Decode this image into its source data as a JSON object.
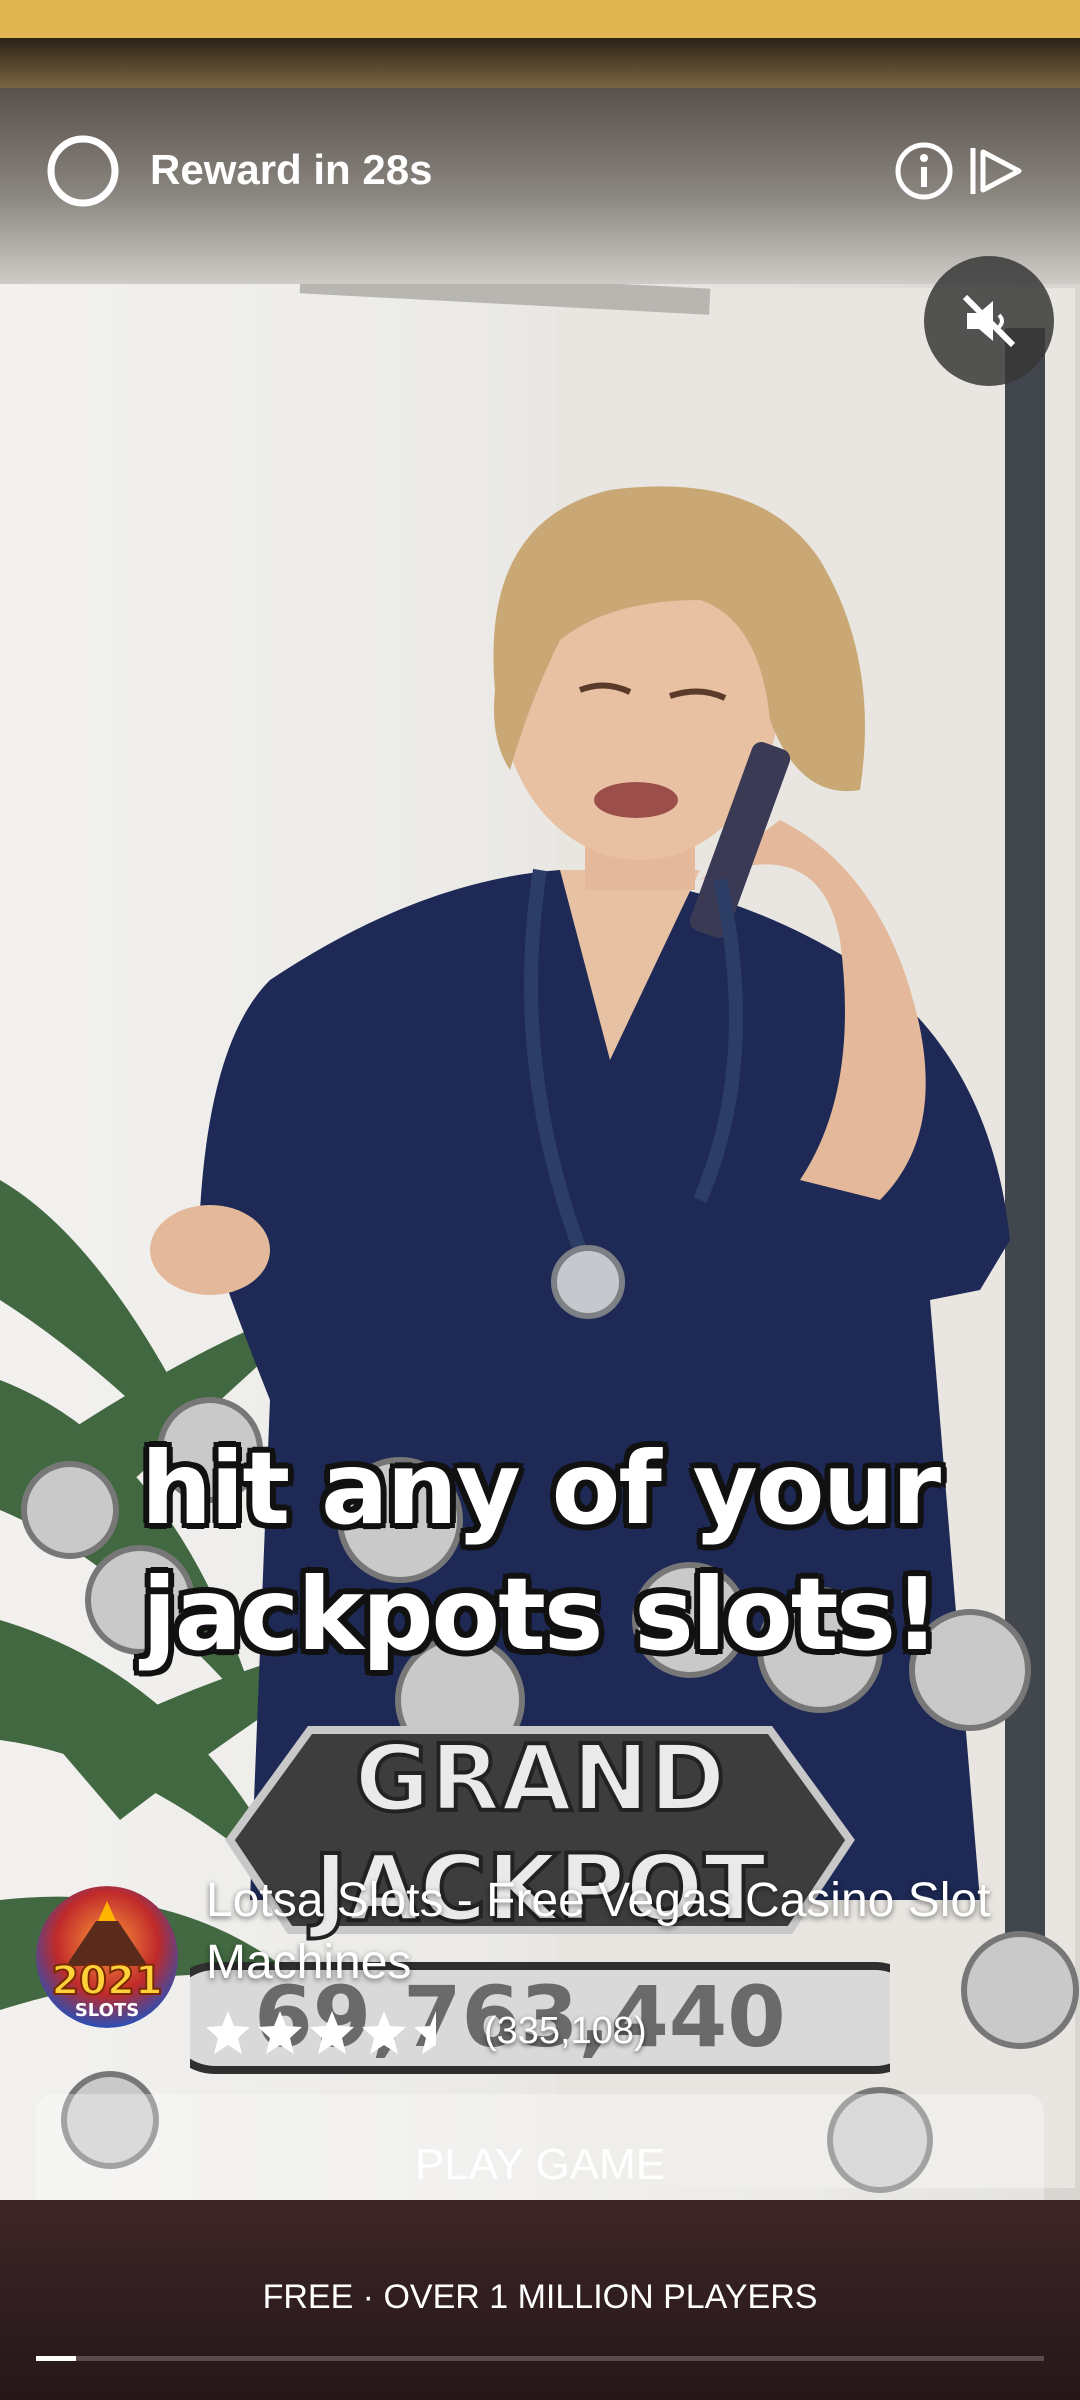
{
  "ad": {
    "reward_label": "Reward in 28s",
    "caption_line1": "hit any of your",
    "caption_line2": "jackpots slots!",
    "banner_word1": "GRAND",
    "banner_word2": "JACKPOT",
    "jackpot_amount": "69,763,440",
    "icon_badge": "2021",
    "icon_badge_sub": "SLOTS"
  },
  "app": {
    "title": "Lotsa Slots - Free Vegas Casino Slot Machines",
    "rating_stars": 4.5,
    "rating_count": "(335,108)",
    "cta_label": "PLAY GAME",
    "tagline": "FREE · OVER 1 MILLION PLAYERS"
  },
  "progress": {
    "fraction": 0.04
  },
  "icons": [
    "timer-ring-icon",
    "info-icon",
    "skip-ad-icon",
    "muted-speaker-icon",
    "star-icon"
  ],
  "colors": {
    "status_bar": "#e0b552",
    "scrubs": "#1e2a55",
    "cta_background": "rgba(255,255,255,0.32)",
    "bottom_panel": "#2d1c1e"
  }
}
